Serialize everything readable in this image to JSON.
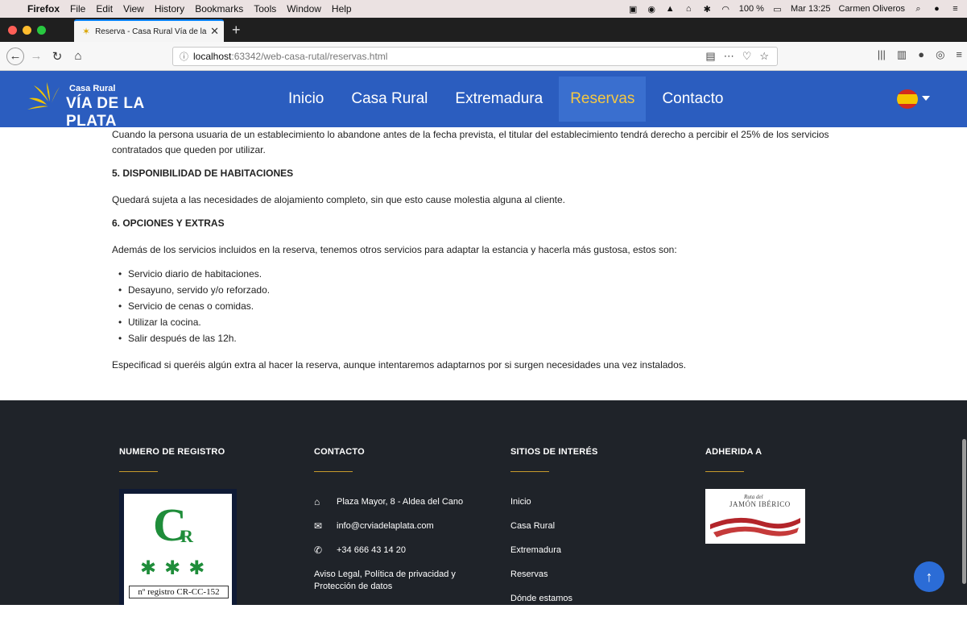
{
  "menubar": {
    "app": "Firefox",
    "items": [
      "File",
      "Edit",
      "View",
      "History",
      "Bookmarks",
      "Tools",
      "Window",
      "Help"
    ],
    "battery": "100 %",
    "clock": "Mar 13:25",
    "user": "Carmen Oliveros"
  },
  "tab": {
    "title": "Reserva - Casa Rural Vía de la P"
  },
  "url": {
    "host": "localhost",
    "path": ":63342/web-casa-rutal/reservas.html"
  },
  "logo": {
    "line1": "Casa Rural",
    "line2": "VÍA DE LA PLATA"
  },
  "nav": [
    "Inicio",
    "Casa Rural",
    "Extremadura",
    "Reservas",
    "Contacto"
  ],
  "nav_active": "Reservas",
  "content": {
    "p_top": "Cuando la persona usuaria de un establecimiento lo abandone antes de la fecha prevista, el titular del establecimiento tendrá derecho a percibir el 25% de los servicios contratados que queden por utilizar.",
    "h5": "5. DISPONIBILIDAD DE HABITACIONES",
    "p5": "Quedará sujeta a las necesidades de alojamiento completo, sin que esto cause molestia alguna al cliente.",
    "h6": "6. OPCIONES Y EXTRAS",
    "p6": "Además de los servicios incluidos en la reserva, tenemos otros servicios para adaptar la estancia y hacerla más gustosa, estos son:",
    "extras": [
      "Servicio diario de habitaciones.",
      "Desayuno, servido y/o reforzado.",
      "Servicio de cenas o comidas.",
      "Utilizar la cocina.",
      "Salir después de las 12h."
    ],
    "p_end": "Especificad si queréis algún extra al hacer la reserva, aunque intentaremos adaptarnos por si surgen necesidades una vez instalados."
  },
  "footer": {
    "col1_title": "NUMERO DE REGISTRO",
    "reg_letters": "C",
    "reg_super": "R",
    "reg_number": "nº registro CR-CC-152",
    "col2_title": "CONTACTO",
    "address": "Plaza Mayor, 8 - Aldea del Cano",
    "email": "info@crviadelaplata.com",
    "phone": "+34 666 43 14 20",
    "legal": "Aviso Legal, Política de privacidad y Protección de datos",
    "col3_title": "SITIOS DE INTERÉS",
    "links": [
      "Inicio",
      "Casa Rural",
      "Extremadura",
      "Reservas",
      "Dónde estamos"
    ],
    "col4_title": "ADHERIDA A",
    "jamon_small": "Ruta del",
    "jamon_big": "JAMÓN IBÉRICO"
  },
  "colors": {
    "header": "#2b5dbf",
    "footer": "#1f2329",
    "accent": "#f5c842"
  }
}
